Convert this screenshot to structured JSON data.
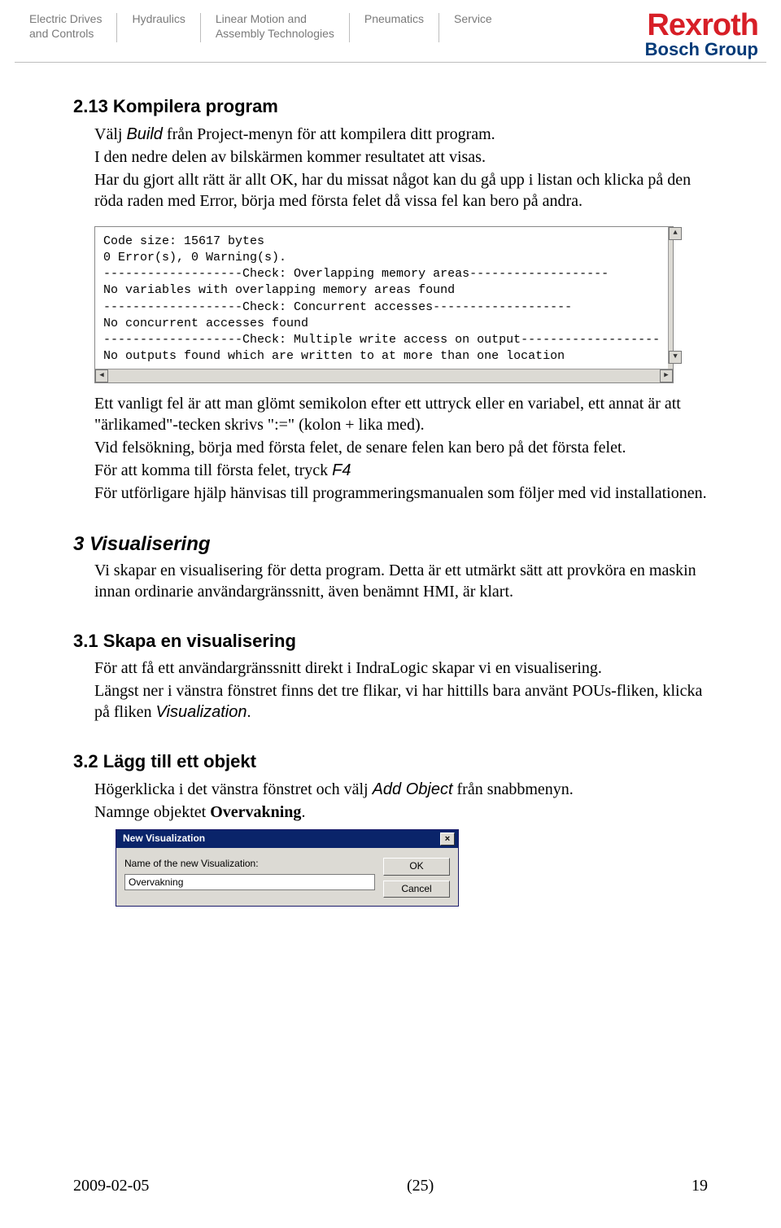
{
  "header": {
    "items": [
      "Electric Drives\nand Controls",
      "Hydraulics",
      "Linear Motion and\nAssembly Technologies",
      "Pneumatics",
      "Service"
    ],
    "logo_main": "Rexroth",
    "logo_sub": "Bosch Group"
  },
  "section_213": {
    "title": "2.13 Kompilera program",
    "p1_a": "Välj ",
    "p1_kw": "Build",
    "p1_b": " från Project-menyn för att kompilera ditt program.",
    "p2": "I den nedre delen av bilskärmen kommer resultatet att visas.",
    "p3": "Har du gjort allt rätt är allt OK, har du missat något kan du gå upp i listan och klicka på den röda raden med Error, börja med första felet då vissa fel kan bero på andra."
  },
  "code_panel": {
    "lines": [
      "Code size: 15617 bytes",
      "0 Error(s), 0 Warning(s).",
      "-------------------Check: Overlapping memory areas-------------------",
      "No variables with overlapping memory areas found",
      "-------------------Check: Concurrent accesses-------------------",
      "No concurrent accesses found",
      "-------------------Check: Multiple write access on output-------------------",
      "No outputs found which are written to at more than one location"
    ]
  },
  "after_code": {
    "p1": "Ett vanligt fel är att man glömt semikolon efter ett uttryck eller en variabel, ett annat är att \"ärlikamed\"-tecken skrivs \":=\" (kolon + lika med).",
    "p2": "Vid felsökning, börja med första felet, de senare felen kan bero på det första felet.",
    "p3_a": "För att komma till första felet, tryck ",
    "p3_kw": "F4",
    "p4": "För utförligare hjälp hänvisas till programmeringsmanualen som följer med vid installationen."
  },
  "section_3": {
    "title": "3 Visualisering",
    "p1": "Vi skapar en visualisering för detta program. Detta är ett utmärkt sätt att provköra en maskin innan ordinarie användargränssnitt, även benämnt HMI, är klart."
  },
  "section_31": {
    "title": "3.1 Skapa en visualisering",
    "p1": "För att få ett användargränssnitt direkt i IndraLogic skapar vi en visualisering.",
    "p2_a": "Längst ner i vänstra fönstret finns det tre flikar, vi har hittills bara använt POUs-fliken, klicka på fliken ",
    "p2_kw": "Visualization",
    "p2_b": "."
  },
  "section_32": {
    "title": "3.2 Lägg till ett objekt",
    "p1_a": "Högerklicka i det vänstra fönstret och välj ",
    "p1_kw": "Add Object",
    "p1_b": " från snabbmenyn.",
    "p2_a": "Namnge objektet ",
    "p2_kw": "Overvakning",
    "p2_b": "."
  },
  "dialog": {
    "title": "New Visualization",
    "label": "Name of the new Visualization:",
    "value": "Overvakning",
    "ok": "OK",
    "cancel": "Cancel"
  },
  "footer": {
    "date": "2009-02-05",
    "center": "(25)",
    "page": "19"
  }
}
